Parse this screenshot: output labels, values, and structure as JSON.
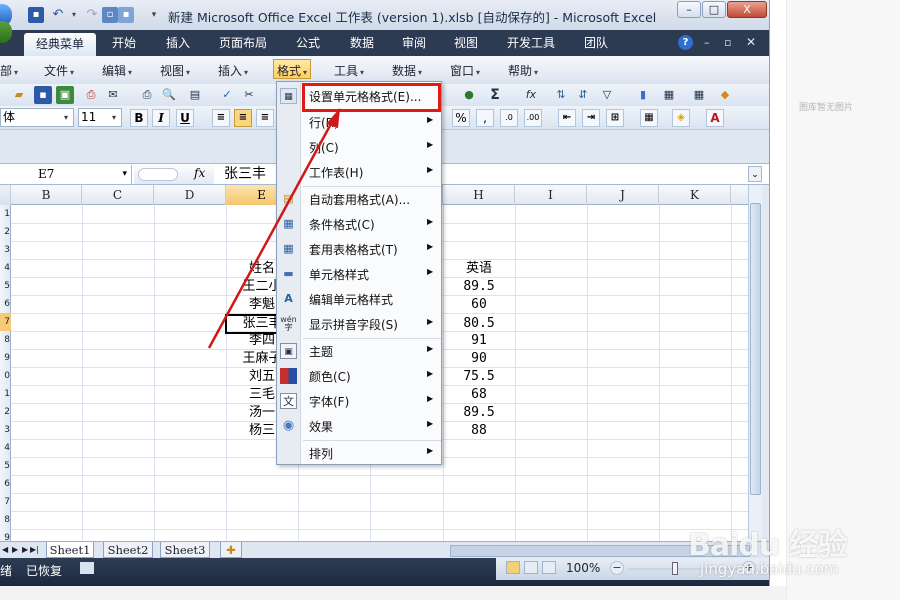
{
  "window": {
    "title": "新建 Microsoft Office Excel 工作表 (version 1).xlsb [自动保存的] - Microsoft Excel",
    "min": "–",
    "max": "□",
    "close": "X"
  },
  "ribbon": {
    "tabs": [
      "经典菜单",
      "开始",
      "插入",
      "页面布局",
      "公式",
      "数据",
      "审阅",
      "视图",
      "开发工具",
      "团队"
    ]
  },
  "menubar": {
    "items": [
      "部",
      "文件",
      "编辑",
      "视图",
      "插入",
      "格式",
      "工具",
      "数据",
      "窗口",
      "帮助"
    ]
  },
  "fontbar": {
    "font": "体",
    "size": "11",
    "bold": "B",
    "italic": "I",
    "underline": "U",
    "percent": "%",
    "comma": ","
  },
  "formula_bar": {
    "name_box": "E7",
    "fx": "fx",
    "content": "张三丰"
  },
  "grid": {
    "columns": [
      "B",
      "C",
      "D",
      "E",
      "F",
      "G",
      "H",
      "I",
      "J",
      "K"
    ],
    "active_column": "E",
    "rows": [
      "1",
      "2",
      "3",
      "4",
      "5",
      "6",
      "7",
      "8",
      "9",
      "0",
      "1",
      "2",
      "3",
      "4",
      "5",
      "6",
      "7",
      "8",
      "9"
    ],
    "colE": [
      "姓名",
      "王二小",
      "李魁",
      "张三丰",
      "李四",
      "王麻子",
      "刘五",
      "三毛",
      "汤一",
      "杨三"
    ],
    "colH": [
      "英语",
      "89.5",
      "60",
      "80.5",
      "91",
      "90",
      "75.5",
      "68",
      "89.5",
      "88"
    ]
  },
  "format_menu": {
    "items": [
      {
        "label": "设置单元格格式(E)...",
        "sub": false,
        "icon": "format-cells-icon"
      },
      {
        "label": "行(R)",
        "sub": true,
        "icon": ""
      },
      {
        "label": "列(C)",
        "sub": true,
        "icon": ""
      },
      {
        "label": "工作表(H)",
        "sub": true,
        "icon": ""
      },
      {
        "label": "自动套用格式(A)...",
        "sub": false,
        "icon": "autoformat-icon"
      },
      {
        "label": "条件格式(C)",
        "sub": true,
        "icon": "conditional-format-icon"
      },
      {
        "label": "套用表格格式(T)",
        "sub": true,
        "icon": "table-format-icon"
      },
      {
        "label": "单元格样式",
        "sub": true,
        "icon": "cell-styles-icon"
      },
      {
        "label": "编辑单元格样式",
        "sub": false,
        "icon": "edit-style-icon"
      },
      {
        "label": "显示拼音字段(S)",
        "sub": true,
        "icon": "phonetic-icon"
      },
      {
        "label": "主题",
        "sub": true,
        "icon": "theme-icon"
      },
      {
        "label": "颜色(C)",
        "sub": true,
        "icon": "colors-icon"
      },
      {
        "label": "字体(F)",
        "sub": true,
        "icon": "fonts-icon"
      },
      {
        "label": "效果",
        "sub": true,
        "icon": "effects-icon"
      },
      {
        "label": "排列",
        "sub": true,
        "icon": ""
      }
    ],
    "pinyin_icon_text": "wén",
    "font_icon_text": "文"
  },
  "sheets": [
    "Sheet1",
    "Sheet2",
    "Sheet3"
  ],
  "status": {
    "left": "绪",
    "autosave": "已恢复",
    "zoom": "100%"
  },
  "side_panel": {
    "text": "图库暂无图片"
  },
  "watermark": {
    "main": "Baidu 经验",
    "sub": "jingyan.baidu.com"
  },
  "colors": {
    "highlight": "#e11a14",
    "arrow": "#d01818",
    "active_header": "#f6c973",
    "ribbon_dark": "#2c3a52"
  }
}
